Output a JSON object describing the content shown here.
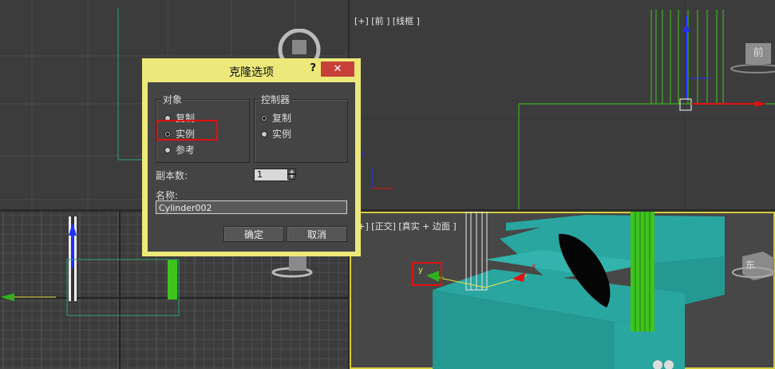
{
  "viewports": {
    "front_label": "[+] [前 ] [线框 ]",
    "ortho_label": "[+] [正交] [真实 + 边面 ]",
    "viewcube_front": "前",
    "viewcube_east": "东",
    "axis_x": "x",
    "axis_y": "y",
    "axis_z": "z"
  },
  "dialog": {
    "title": "克隆选项",
    "help": "?",
    "close": "✕",
    "object_group": {
      "label": "对象",
      "options": [
        "复制",
        "实例",
        "参考"
      ],
      "selected": "实例"
    },
    "controller_group": {
      "label": "控制器",
      "options": [
        "复制",
        "实例"
      ],
      "selected": "复制"
    },
    "copies_label": "副本数:",
    "copies_value": "1",
    "name_label": "名称:",
    "name_value": "Cylinder002",
    "ok_label": "确定",
    "cancel_label": "取消"
  },
  "colors": {
    "highlight": "#e01010",
    "dialog_frame": "#ece97a",
    "active_viewport_border": "#d4cc3c",
    "object_teal": "#2aa6a0",
    "cylinder_green": "#3fc41e"
  }
}
